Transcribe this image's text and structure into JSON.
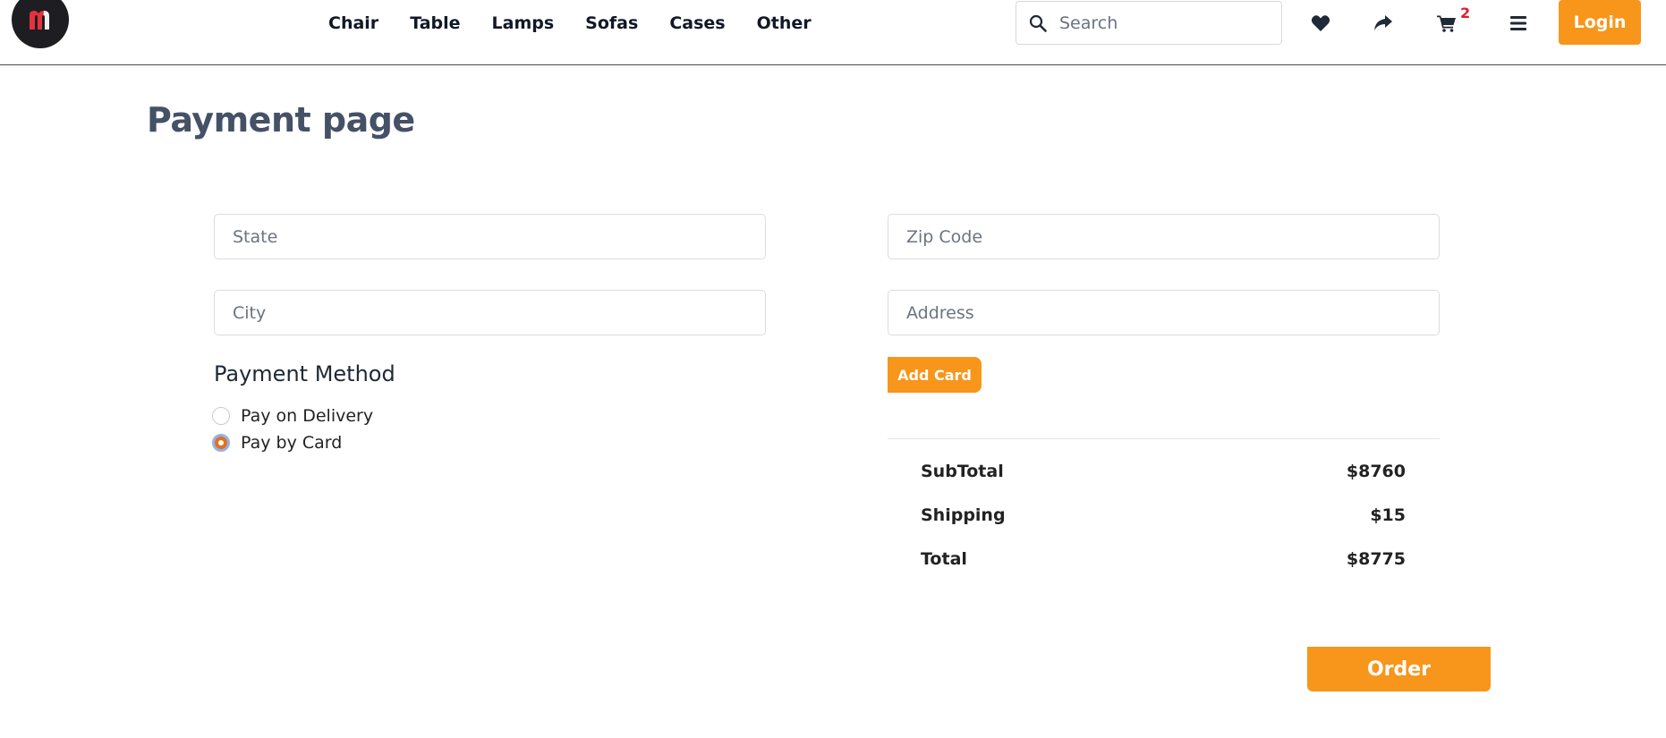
{
  "header": {
    "logo_icon": "m-logo-icon",
    "nav": [
      {
        "label": "Chair"
      },
      {
        "label": "Table"
      },
      {
        "label": "Lamps"
      },
      {
        "label": "Sofas"
      },
      {
        "label": "Cases"
      },
      {
        "label": "Other"
      }
    ],
    "search": {
      "placeholder": "Search",
      "icon": "search-icon"
    },
    "icons": [
      "heart-icon",
      "share-icon",
      "cart-icon",
      "menu-icon"
    ],
    "cart_count": "2",
    "login_label": "Login"
  },
  "page": {
    "title": "Payment page"
  },
  "form": {
    "state_placeholder": "State",
    "zip_placeholder": "Zip Code",
    "city_placeholder": "City",
    "address_placeholder": "Address",
    "add_card_label": "Add Card"
  },
  "payment": {
    "title": "Payment Method",
    "options": [
      {
        "label": "Pay on Delivery",
        "selected": false
      },
      {
        "label": "Pay by Card",
        "selected": true
      }
    ]
  },
  "summary": {
    "rows": [
      {
        "label": "SubTotal",
        "value": "$8760"
      },
      {
        "label": "Shipping",
        "value": "$15"
      },
      {
        "label": "Total",
        "value": "$8775"
      }
    ]
  },
  "order_label": "Order",
  "colors": {
    "accent": "#f7961b",
    "title": "#445166",
    "badge": "#e11d2a",
    "logo_bg": "#1e1e22",
    "logo_mark": "#e5323e"
  }
}
